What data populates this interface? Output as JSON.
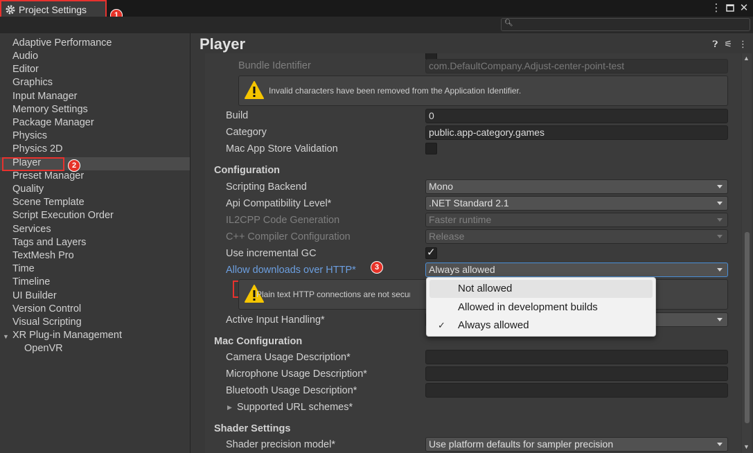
{
  "window": {
    "title": "Project Settings",
    "icons": [
      "gear-icon",
      "more-vert-icon",
      "maximize-icon",
      "close-icon"
    ]
  },
  "badges": [
    "1",
    "2",
    "3"
  ],
  "sidebar": {
    "items": [
      "Adaptive Performance",
      "Audio",
      "Editor",
      "Graphics",
      "Input Manager",
      "Memory Settings",
      "Package Manager",
      "Physics",
      "Physics 2D",
      "Player",
      "Preset Manager",
      "Quality",
      "Scene Template",
      "Script Execution Order",
      "Services",
      "Tags and Layers",
      "TextMesh Pro",
      "Time",
      "Timeline",
      "UI Builder",
      "Version Control",
      "Visual Scripting",
      "XR Plug-in Management",
      "OpenVR"
    ],
    "selected": "Player"
  },
  "main": {
    "title": "Player",
    "bundle_identifier": {
      "label": "Bundle Identifier",
      "value": "com.DefaultCompany.Adjust-center-point-test"
    },
    "warning_app_id": "Invalid characters have been removed from the Application Identifier.",
    "build": {
      "label": "Build",
      "value": "0"
    },
    "category": {
      "label": "Category",
      "value": "public.app-category.games"
    },
    "mac_app_store_validation": {
      "label": "Mac App Store Validation",
      "checked": false
    },
    "configuration": {
      "heading": "Configuration",
      "scripting_backend": {
        "label": "Scripting Backend",
        "value": "Mono"
      },
      "api_compat": {
        "label": "Api Compatibility Level*",
        "value": ".NET Standard 2.1"
      },
      "il2cpp_codegen": {
        "label": "IL2CPP Code Generation",
        "value": "Faster runtime"
      },
      "cpp_compiler": {
        "label": "C++ Compiler Configuration",
        "value": "Release"
      },
      "incremental_gc": {
        "label": "Use incremental GC",
        "checked": true
      },
      "allow_http": {
        "label": "Allow downloads over HTTP*",
        "value": "Always allowed"
      },
      "http_warning": "Plain text HTTP connections are not secure",
      "active_input": {
        "label": "Active Input Handling*",
        "value": ""
      }
    },
    "mac_configuration": {
      "heading": "Mac Configuration",
      "camera": {
        "label": "Camera Usage Description*",
        "value": ""
      },
      "microphone": {
        "label": "Microphone Usage Description*",
        "value": ""
      },
      "bluetooth": {
        "label": "Bluetooth Usage Description*",
        "value": ""
      },
      "url_schemes": "Supported URL schemes*"
    },
    "shader_settings": {
      "heading": "Shader Settings",
      "precision": {
        "label": "Shader precision model*",
        "value": "Use platform defaults for sampler precision"
      }
    }
  },
  "popup": {
    "options": [
      "Not allowed",
      "Allowed in development builds",
      "Always allowed"
    ],
    "selected": "Always allowed",
    "hovered": "Not allowed"
  },
  "colors": {
    "accent_red": "#e8322e",
    "link_blue": "#6c9fe0",
    "focus_blue": "#4a8fd8"
  }
}
